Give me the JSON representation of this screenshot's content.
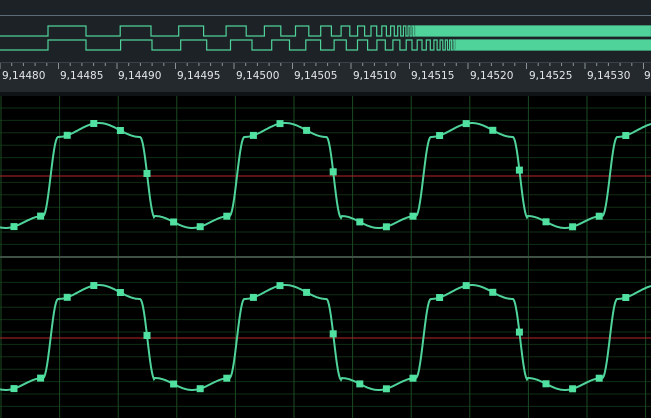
{
  "colors": {
    "trace": "#4fd39a",
    "marker": "#50e0a0",
    "grid": "#1b4a22",
    "grid_minor": "#0f2f14",
    "midline": "#b8262c",
    "overview_bg": "#1d2226",
    "ruler_bg": "#24292e",
    "ruler_text": "#e2e6ea"
  },
  "ruler": {
    "ticks": [
      "9,14480",
      "9,14485",
      "9,14490",
      "9,14495",
      "9,14500",
      "9,14505",
      "9,14510",
      "9,14515",
      "9,14520",
      "9,14525",
      "9,14530",
      "9"
    ]
  },
  "channels": [
    {
      "id": "channel-1"
    },
    {
      "id": "channel-2"
    }
  ]
}
